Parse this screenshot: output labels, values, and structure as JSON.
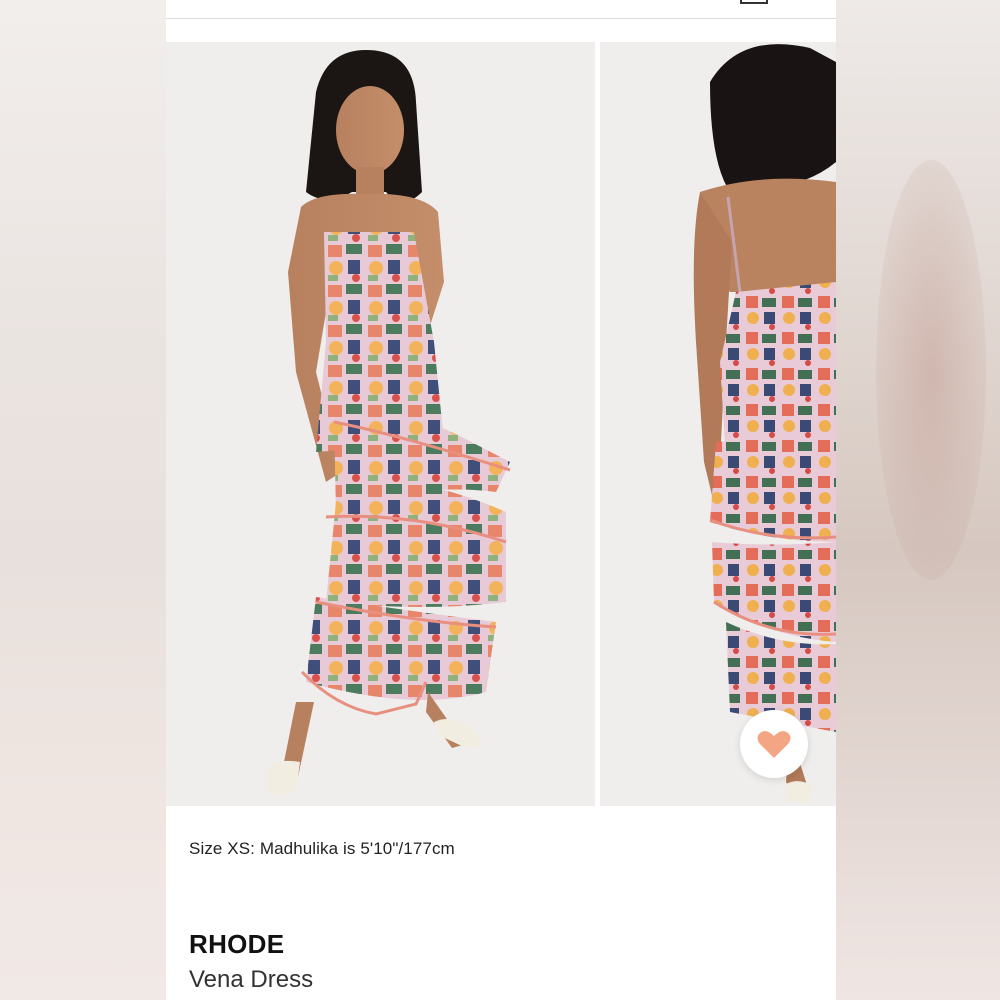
{
  "product": {
    "size_note": "Size XS: Madhulika is 5'10\"/177cm",
    "brand": "RHODE",
    "name": "Vena Dress"
  },
  "icons": {
    "favorite": "heart-icon",
    "bag": "shopping-bag-icon"
  },
  "colors": {
    "heart": "#f4a583",
    "background": "#ffffff",
    "text": "#222222"
  }
}
